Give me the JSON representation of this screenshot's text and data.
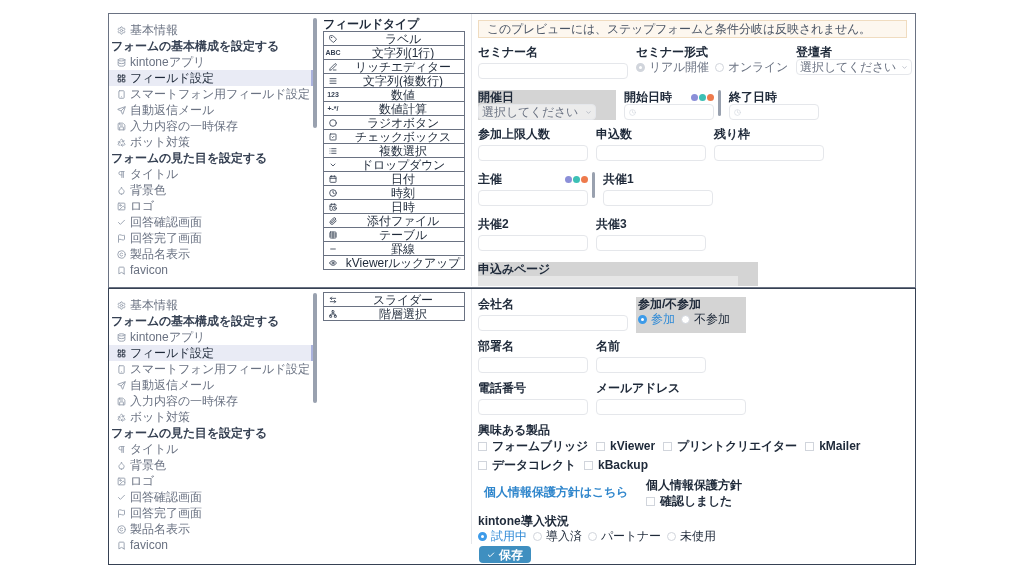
{
  "panels": [
    {
      "sidebar": [
        {
          "kind": "item",
          "label": "基本情報",
          "selected": false
        },
        {
          "kind": "heading",
          "label": "フォームの基本構成を設定する"
        },
        {
          "kind": "item",
          "label": "kintoneアプリ",
          "selected": false
        },
        {
          "kind": "item",
          "label": "フィールド設定",
          "selected": true
        },
        {
          "kind": "item",
          "label": "スマートフォン用フィールド設定",
          "selected": false
        },
        {
          "kind": "item",
          "label": "自動返信メール",
          "selected": false
        },
        {
          "kind": "item",
          "label": "入力内容の一時保存",
          "selected": false
        },
        {
          "kind": "item",
          "label": "ボット対策",
          "selected": false
        },
        {
          "kind": "heading",
          "label": "フォームの見た目を設定する"
        },
        {
          "kind": "item",
          "label": "タイトル",
          "selected": false
        },
        {
          "kind": "item",
          "label": "背景色",
          "selected": false
        },
        {
          "kind": "item",
          "label": "ロゴ",
          "selected": false
        },
        {
          "kind": "item",
          "label": "回答確認画面",
          "selected": false
        },
        {
          "kind": "item",
          "label": "回答完了画面",
          "selected": false
        },
        {
          "kind": "item",
          "label": "製品名表示",
          "selected": false
        },
        {
          "kind": "item",
          "label": "favicon",
          "selected": false
        }
      ],
      "field_types_title": "フィールドタイプ",
      "field_types": [
        {
          "label": "ラベル"
        },
        {
          "label": "文字列(1行)",
          "glyph": "ABC"
        },
        {
          "label": "リッチエディター"
        },
        {
          "label": "文字列(複数行)"
        },
        {
          "label": "数値",
          "glyph": "123"
        },
        {
          "label": "数値計算",
          "glyph": "+-*/"
        },
        {
          "label": "ラジオボタン"
        },
        {
          "label": "チェックボックス"
        },
        {
          "label": "複数選択"
        },
        {
          "label": "ドロップダウン"
        },
        {
          "label": "日付"
        },
        {
          "label": "時刻"
        },
        {
          "label": "日時"
        },
        {
          "label": "添付ファイル"
        },
        {
          "label": "テーブル"
        },
        {
          "label": "罫線"
        },
        {
          "label": "kViewerルックアップ"
        }
      ],
      "form": {
        "notice": "このプレビューには、ステップフォームと条件分岐は反映されません。",
        "rows": [
          [
            {
              "kind": "wide-text",
              "label": "セミナー名"
            },
            {
              "kind": "radio",
              "label": "セミナー形式",
              "disabled": true,
              "options": [
                {
                  "label": "リアル開催",
                  "selected": true
                },
                {
                  "label": "オンライン",
                  "selected": false
                }
              ]
            },
            {
              "kind": "select",
              "label": "登壇者",
              "placeholder": "選択してください",
              "disabled": false
            }
          ],
          [
            {
              "kind": "select",
              "label": "開催日",
              "placeholder": "選択してください",
              "disabled": true,
              "highlighted": true
            },
            {
              "kind": "time",
              "label": "開始日時",
              "toolbar": true
            },
            {
              "kind": "time",
              "label": "終了日時"
            }
          ],
          [
            {
              "kind": "text",
              "label": "参加上限人数"
            },
            {
              "kind": "text",
              "label": "申込数"
            },
            {
              "kind": "text",
              "label": "残り枠"
            }
          ],
          [
            {
              "kind": "text",
              "label": "主催",
              "toolbar": true
            },
            {
              "kind": "text",
              "label": "共催1"
            }
          ],
          [
            {
              "kind": "text",
              "label": "共催2"
            },
            {
              "kind": "text",
              "label": "共催3"
            }
          ],
          [
            {
              "kind": "block",
              "label": "申込みページ",
              "highlighted": true
            }
          ]
        ]
      }
    },
    {
      "sidebar": [
        {
          "kind": "item",
          "label": "基本情報",
          "selected": false
        },
        {
          "kind": "heading",
          "label": "フォームの基本構成を設定する"
        },
        {
          "kind": "item",
          "label": "kintoneアプリ",
          "selected": false
        },
        {
          "kind": "item",
          "label": "フィールド設定",
          "selected": true
        },
        {
          "kind": "item",
          "label": "スマートフォン用フィールド設定",
          "selected": false
        },
        {
          "kind": "item",
          "label": "自動返信メール",
          "selected": false
        },
        {
          "kind": "item",
          "label": "入力内容の一時保存",
          "selected": false
        },
        {
          "kind": "item",
          "label": "ボット対策",
          "selected": false
        },
        {
          "kind": "heading",
          "label": "フォームの見た目を設定する"
        },
        {
          "kind": "item",
          "label": "タイトル",
          "selected": false
        },
        {
          "kind": "item",
          "label": "背景色",
          "selected": false
        },
        {
          "kind": "item",
          "label": "ロゴ",
          "selected": false
        },
        {
          "kind": "item",
          "label": "回答確認画面",
          "selected": false
        },
        {
          "kind": "item",
          "label": "回答完了画面",
          "selected": false
        },
        {
          "kind": "item",
          "label": "製品名表示",
          "selected": false
        },
        {
          "kind": "item",
          "label": "favicon",
          "selected": false
        }
      ],
      "field_types": [
        {
          "label": "スライダー"
        },
        {
          "label": "階層選択"
        }
      ],
      "form": {
        "rows": [
          [
            {
              "kind": "wide-text",
              "label": "会社名"
            },
            {
              "kind": "radio",
              "label": "参加/不参加",
              "disabled": false,
              "highlighted": true,
              "options": [
                {
                  "label": "参加",
                  "selected": true
                },
                {
                  "label": "不参加",
                  "selected": false
                }
              ]
            }
          ],
          [
            {
              "kind": "text",
              "label": "部署名"
            },
            {
              "kind": "text",
              "label": "名前"
            }
          ],
          [
            {
              "kind": "text",
              "label": "電話番号"
            },
            {
              "kind": "wide-text",
              "label": "メールアドレス"
            }
          ],
          [
            {
              "kind": "checkboxes",
              "label": "興味ある製品",
              "options": [
                {
                  "label": "フォームブリッジ",
                  "checked": false
                },
                {
                  "label": "kViewer",
                  "checked": false
                },
                {
                  "label": "プリントクリエイター",
                  "checked": false
                },
                {
                  "label": "kMailer",
                  "checked": false
                },
                {
                  "label": "データコレクト",
                  "checked": false
                },
                {
                  "label": "kBackup",
                  "checked": false
                }
              ]
            }
          ],
          [
            {
              "kind": "link",
              "text": "個人情報保護方針はこちら"
            },
            {
              "kind": "checkboxes",
              "label": "個人情報保護方針",
              "options": [
                {
                  "label": "確認しました",
                  "checked": false
                }
              ]
            }
          ],
          [
            {
              "kind": "radio",
              "label": "kintone導入状況",
              "disabled": false,
              "options": [
                {
                  "label": "試用中",
                  "selected": true
                },
                {
                  "label": "導入済",
                  "selected": false
                },
                {
                  "label": "パートナー",
                  "selected": false
                },
                {
                  "label": "未使用",
                  "selected": false
                }
              ]
            }
          ]
        ],
        "save_button": "保存"
      }
    }
  ]
}
